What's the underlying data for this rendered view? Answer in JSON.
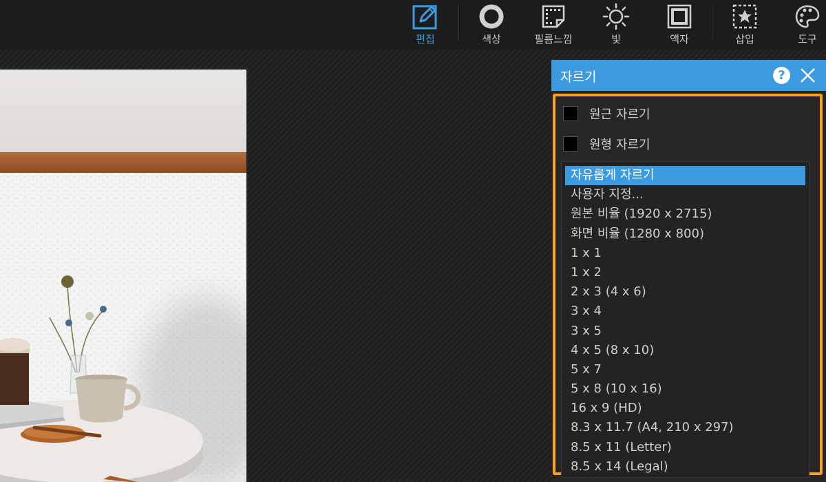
{
  "toolbar": {
    "tools": [
      {
        "id": "edit",
        "label": "편집",
        "icon": "edit-icon",
        "active": true
      },
      {
        "id": "color",
        "label": "색상",
        "icon": "ring-icon",
        "active": false
      },
      {
        "id": "film",
        "label": "필름느낌",
        "icon": "film-icon",
        "active": false
      },
      {
        "id": "light",
        "label": "빛",
        "icon": "sun-icon",
        "active": false
      },
      {
        "id": "frame",
        "label": "액자",
        "icon": "frame-icon",
        "active": false
      },
      {
        "id": "insert",
        "label": "삽입",
        "icon": "star-box-icon",
        "active": false
      },
      {
        "id": "tools",
        "label": "도구",
        "icon": "palette-icon",
        "active": false
      }
    ],
    "accent": "#3d9be0"
  },
  "panel": {
    "title": "자르기",
    "help_label": "?",
    "checkboxes": [
      {
        "label": "원근 자르기",
        "checked": false
      },
      {
        "label": "원형 자르기",
        "checked": false
      }
    ],
    "ratio_options": [
      "자유롭게 자르기",
      "사용자 지정...",
      "원본 비율 (1920 x 2715)",
      "화면 비율 (1280 x 800)",
      "1 x 1",
      "1 x 2",
      "2 x 3 (4 x 6)",
      "3 x 4",
      "3 x 5",
      "4 x 5 (8 x 10)",
      "5 x 7",
      "5 x 8 (10 x 16)",
      "16 x 9 (HD)",
      "8.3 x 11.7 (A4, 210 x 297)",
      "8.5 x 11 (Letter)",
      "8.5 x 14 (Legal)"
    ],
    "selected_option": "자유롭게 자르기",
    "header_color": "#3c9ae0",
    "highlight_color": "#f9a11b"
  }
}
